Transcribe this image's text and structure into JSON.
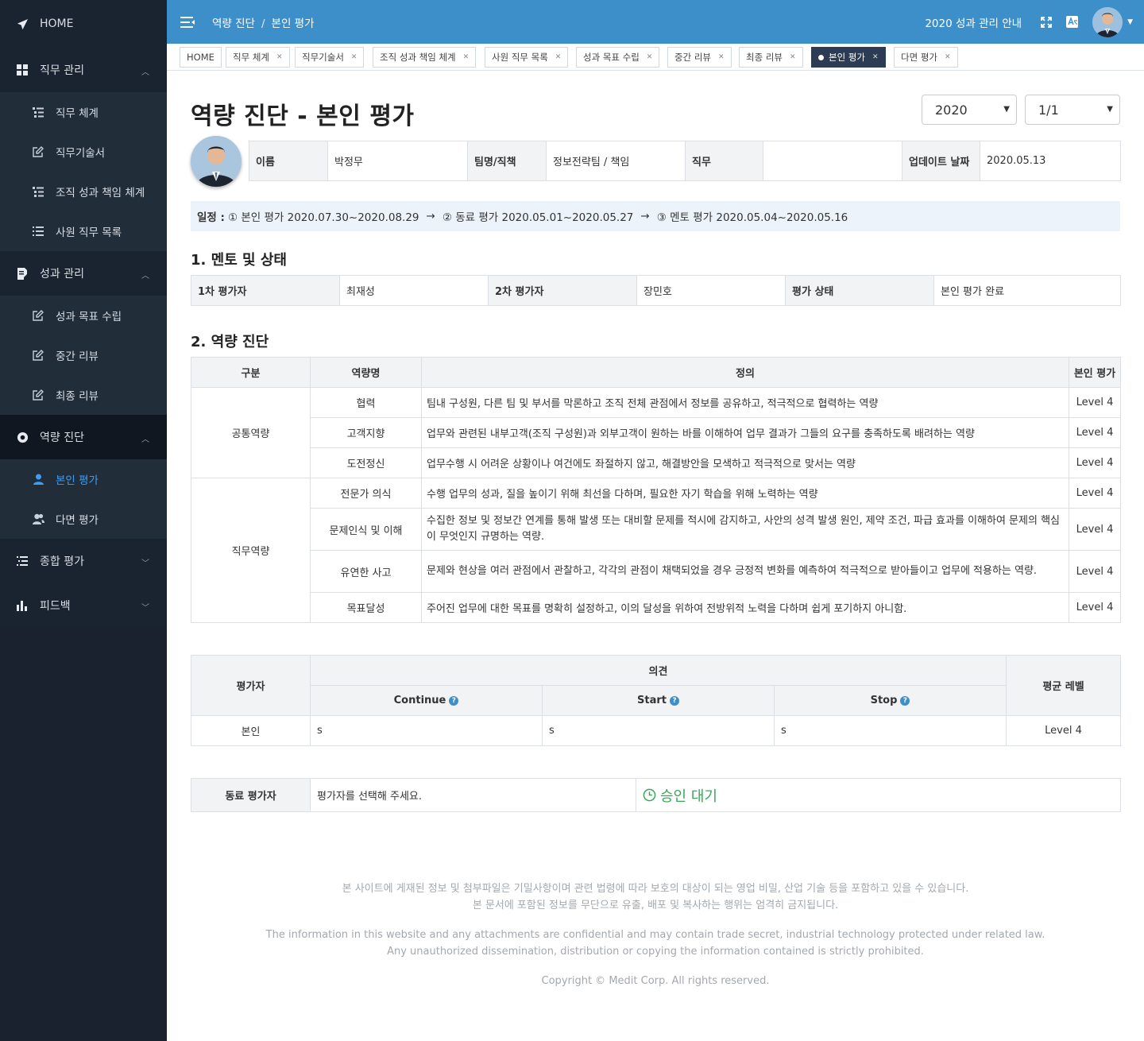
{
  "sidebar": {
    "home": "HOME",
    "sections": [
      {
        "label": "직무 관리",
        "icon": "grid-icon",
        "items": [
          {
            "label": "직무 체계",
            "icon": "list-tree-icon"
          },
          {
            "label": "직무기술서",
            "icon": "edit-icon"
          },
          {
            "label": "조직 성과 책임 체계",
            "icon": "list-tree-icon"
          },
          {
            "label": "사원 직무 목록",
            "icon": "list-icon"
          }
        ]
      },
      {
        "label": "성과 관리",
        "icon": "document-edit-icon",
        "items": [
          {
            "label": "성과 목표 수립",
            "icon": "edit-icon"
          },
          {
            "label": "중간 리뷰",
            "icon": "edit-icon"
          },
          {
            "label": "최종 리뷰",
            "icon": "edit-icon"
          }
        ]
      },
      {
        "label": "역량 진단",
        "icon": "lifebuoy-icon",
        "items": [
          {
            "label": "본인 평가",
            "icon": "user-icon"
          },
          {
            "label": "다면 평가",
            "icon": "users-icon"
          }
        ]
      },
      {
        "label": "종합 평가",
        "icon": "list-ordered-icon"
      },
      {
        "label": "피드백",
        "icon": "bar-chart-icon"
      }
    ]
  },
  "topbar": {
    "breadcrumb": [
      "역량 진단",
      "본인 평가"
    ],
    "notice_link": "2020 성과 관리 안내"
  },
  "tabs": [
    {
      "label": "HOME",
      "closable": false
    },
    {
      "label": "직무 체계",
      "closable": true
    },
    {
      "label": "직무기술서",
      "closable": true
    },
    {
      "label": "조직 성과 책임 체계",
      "closable": true
    },
    {
      "label": "사원 직무 목록",
      "closable": true
    },
    {
      "label": "성과 목표 수립",
      "closable": true
    },
    {
      "label": "중간 리뷰",
      "closable": true
    },
    {
      "label": "최종 리뷰",
      "closable": true
    },
    {
      "label": "본인 평가",
      "closable": true,
      "active": true
    },
    {
      "label": "다면 평가",
      "closable": true
    }
  ],
  "page": {
    "title": "역량 진단 - 본인 평가",
    "year_select": "2020",
    "page_select": "1/1"
  },
  "profile": {
    "name_label": "이름",
    "name": "박정무",
    "team_label": "팀명/직책",
    "team": "정보전략팀 / 책임",
    "job_label": "직무",
    "job": "",
    "updated_label": "업데이트 날짜",
    "updated": "2020.05.13"
  },
  "schedule": {
    "label": "일정 :",
    "steps": [
      "① 본인 평가 2020.07.30~2020.08.29",
      "② 동료 평가 2020.05.01~2020.05.27",
      "③ 멘토 평가 2020.05.04~2020.05.16"
    ],
    "arrow": "→"
  },
  "mentor": {
    "title": "1. 멘토 및 상태",
    "first_label": "1차 평가자",
    "first": "최재성",
    "second_label": "2차 평가자",
    "second": "장민호",
    "status_label": "평가 상태",
    "status": "본인 평가 완료"
  },
  "competency": {
    "title": "2. 역량 진단",
    "headers": [
      "구분",
      "역량명",
      "정의",
      "본인 평가"
    ],
    "groups": [
      {
        "name": "공통역량",
        "rows": [
          {
            "name": "협력",
            "definition": "팀내 구성원, 다른 팀 및 부서를 막론하고 조직 전체 관점에서 정보를 공유하고, 적극적으로 협력하는 역량",
            "level": "Level 4"
          },
          {
            "name": "고객지향",
            "definition": "업무와 관련된 내부고객(조직 구성원)과 외부고객이 원하는 바를 이해하여 업무 결과가 그들의 요구를 충족하도록 배려하는 역량",
            "level": "Level 4"
          },
          {
            "name": "도전정신",
            "definition": "업무수행 시 어려운 상황이나 여건에도 좌절하지 않고, 해결방안을 모색하고 적극적으로 맞서는 역량",
            "level": "Level 4"
          }
        ]
      },
      {
        "name": "직무역량",
        "rows": [
          {
            "name": "전문가 의식",
            "definition": "수행 업무의 성과, 질을 높이기 위해 최선을 다하며, 필요한 자기 학습을 위해 노력하는 역량",
            "level": "Level 4"
          },
          {
            "name": "문제인식 및 이해",
            "definition": "수집한 정보 및 정보간 연계를 통해 발생 또는 대비할 문제를 적시에 감지하고, 사안의 성격 발생 원인, 제약 조건, 파급 효과를 이해하여 문제의 핵심이 무엇인지 규명하는 역량.",
            "level": "Level 4"
          },
          {
            "name": "유연한 사고",
            "definition": "문제와 현상을 여러 관점에서 관찰하고, 각각의 관점이 채택되었을 경우 긍정적 변화를 예측하여 적극적으로 받아들이고 업무에 적용하는 역량.",
            "level": "Level 4"
          },
          {
            "name": "목표달성",
            "definition": "주어진 업무에 대한 목표를 명확히 설정하고, 이의 달성을 위하여 전방위적 노력을 다하며 쉽게 포기하지 아니함.",
            "level": "Level 4"
          }
        ]
      }
    ]
  },
  "opinion": {
    "evaluator_header": "평가자",
    "opinion_header": "의견",
    "continue": "Continue",
    "start": "Start",
    "stop": "Stop",
    "avg_header": "평균 레벨",
    "row": {
      "evaluator": "본인",
      "continue": "s",
      "start": "s",
      "stop": "s",
      "avg": "Level 4"
    }
  },
  "peer": {
    "label": "동료 평가자",
    "placeholder": "평가자를 선택해 주세요.",
    "status": "승인 대기"
  },
  "footer": {
    "ko1": "본 사이트에 게재된 정보 및 첨부파일은 기밀사항이며 관련 법령에 따라 보호의 대상이 되는 영업 비밀, 산업 기술 등을 포함하고 있을 수 있습니다.",
    "ko2": "본 문서에 포함된 정보를 무단으로 유출, 배포 및 복사하는 행위는 엄격히 금지됩니다.",
    "en1": "The information in this website and any attachments are confidential and may contain trade secret, industrial technology protected under related law.",
    "en2": "Any unauthorized dissemination, distribution or copying the information contained is strictly prohibited.",
    "copyright": "Copyright © Medit Corp. All rights reserved."
  },
  "colors": {
    "topbar": "#3d8fca",
    "sidebar": "#19222e",
    "active_link": "#3a9ef3",
    "approve": "#3aa655"
  }
}
